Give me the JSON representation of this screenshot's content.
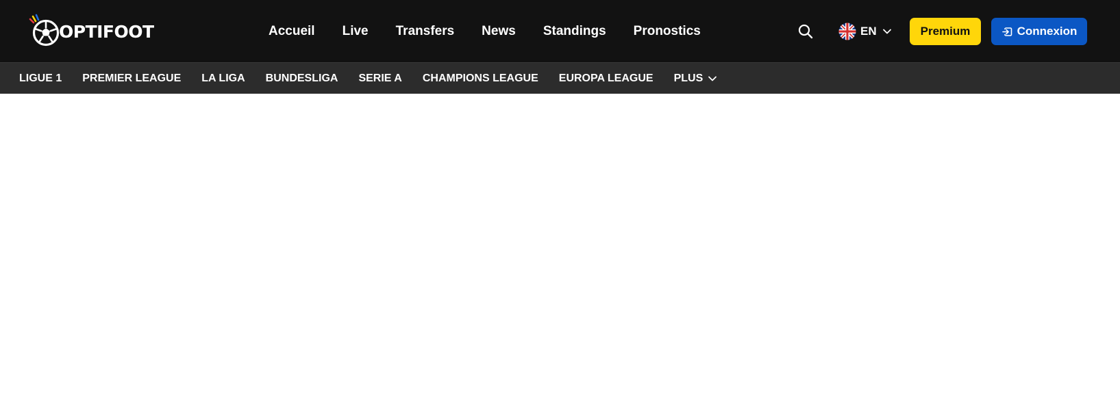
{
  "brand": {
    "name": "OPTIFOOT",
    "logo_icon": "soccer-ball-logo-icon",
    "accent_colors": [
      "#ffd60a",
      "#e63946",
      "#1e6fe0"
    ]
  },
  "main_nav": {
    "items": [
      {
        "label": "Accueil"
      },
      {
        "label": "Live"
      },
      {
        "label": "Transfers"
      },
      {
        "label": "News"
      },
      {
        "label": "Standings"
      },
      {
        "label": "Pronostics"
      }
    ]
  },
  "header_actions": {
    "search_icon": "search-icon",
    "language": {
      "code": "EN",
      "flag_icon": "uk-flag-icon",
      "chevron_icon": "chevron-down-icon"
    },
    "premium_label": "Premium",
    "login_label": "Connexion",
    "login_icon": "login-icon"
  },
  "league_nav": {
    "items": [
      {
        "label": "LIGUE 1"
      },
      {
        "label": "PREMIER LEAGUE"
      },
      {
        "label": "LA LIGA"
      },
      {
        "label": "BUNDESLIGA"
      },
      {
        "label": "SERIE A"
      },
      {
        "label": "CHAMPIONS LEAGUE"
      },
      {
        "label": "EUROPA LEAGUE"
      }
    ],
    "more_label": "PLUS",
    "more_icon": "chevron-down-icon"
  },
  "colors": {
    "topbar_bg": "#121212",
    "subbar_bg": "#2c2c2c",
    "premium_bg": "#ffd60a",
    "login_bg": "#0b57c4"
  }
}
